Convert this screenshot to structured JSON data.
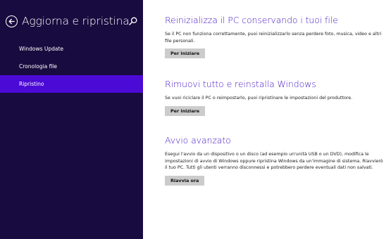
{
  "sidebar": {
    "title": "Aggiorna e ripristina",
    "items": [
      {
        "label": "Windows Update"
      },
      {
        "label": "Cronologia file"
      },
      {
        "label": "Ripristino"
      }
    ]
  },
  "sections": [
    {
      "heading": "Reinizializza il PC conservando i tuoi file",
      "description": "Se il PC non funziona correttamente, puoi reinizializzarlo senza perdere foto, musica, video e altri file personali.",
      "button": "Per iniziare"
    },
    {
      "heading": "Rimuovi tutto e reinstalla Windows",
      "description": "Se vuoi riciclare il PC o reimpostarlo, puoi ripristinare le impostazioni del produttore.",
      "button": "Per iniziare"
    },
    {
      "heading": "Avvio avanzato",
      "description": "Esegui l'avvio da un dispositivo o un disco (ad esempio un'unità USB o un DVD), modifica le impostazioni di avvio di Windows oppure ripristina Windows da un'immagine di sistema. Riavvierò il tuo PC. Tutti gli utenti verranno disconnessi e potrebbero perdere eventuali dati non salvati.",
      "button": "Riavvia ora"
    }
  ],
  "colors": {
    "sidebar_bg": "#180b3f",
    "active_item": "#4b0ad6",
    "heading": "#4517c4"
  }
}
